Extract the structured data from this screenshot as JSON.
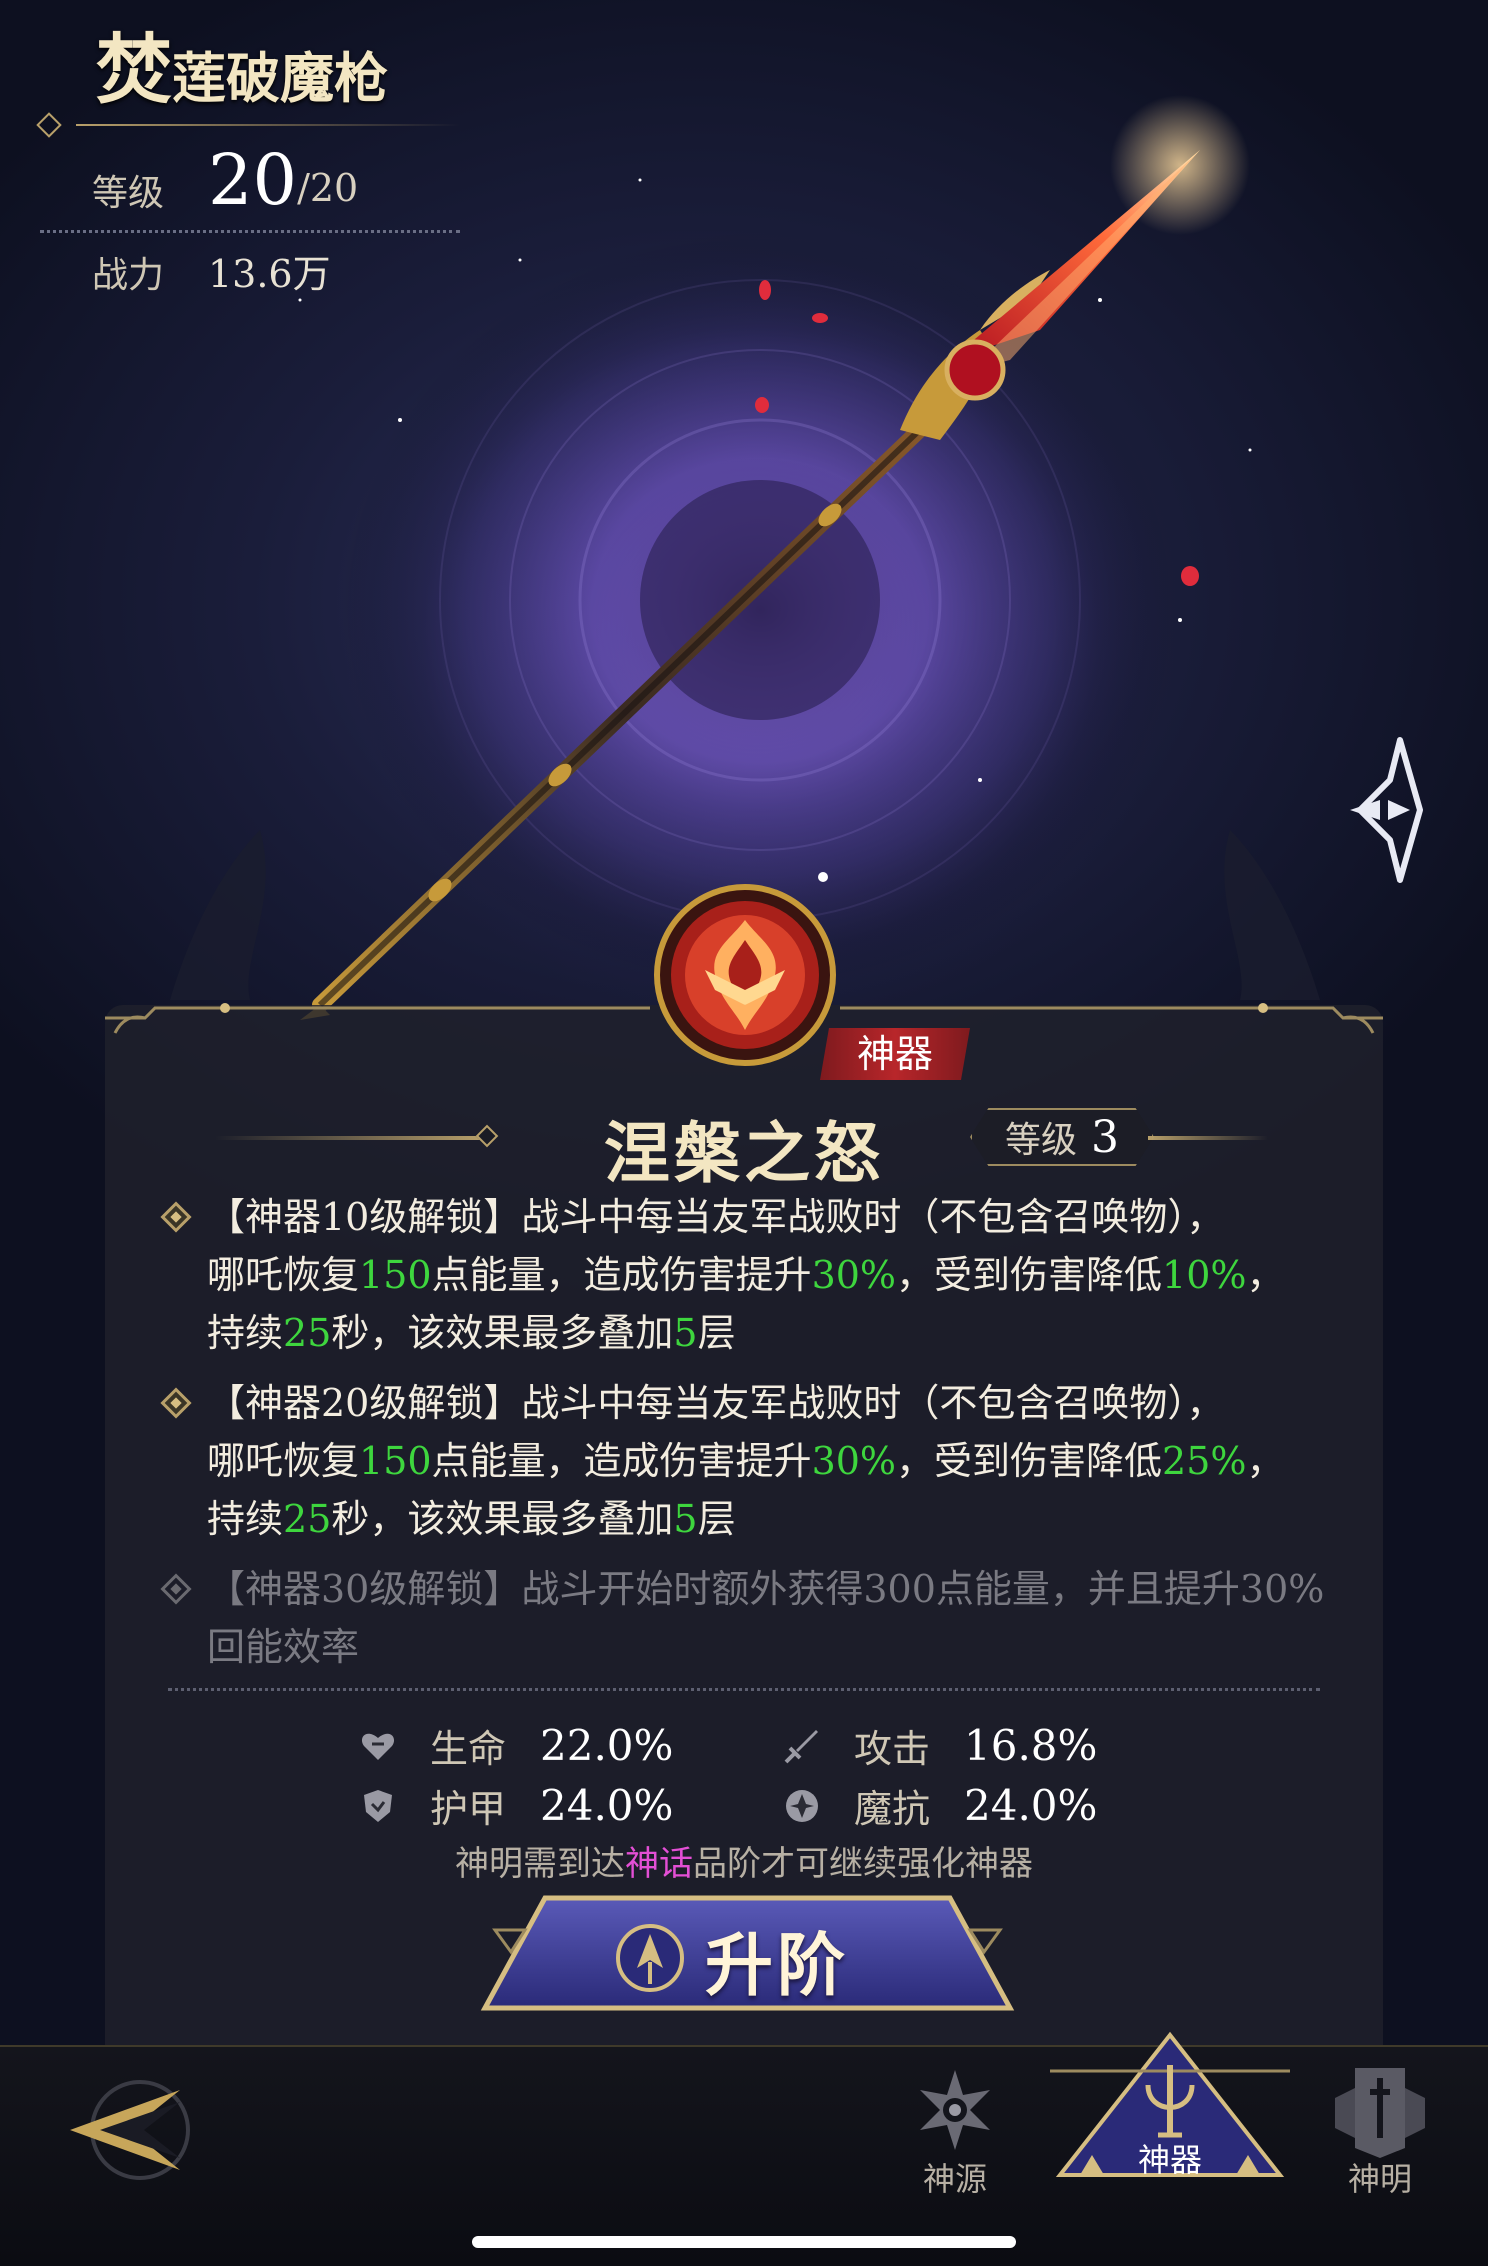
{
  "weapon": {
    "title_first_char": "焚",
    "title_rest": "莲破魔枪",
    "level_label": "等级",
    "level_value": "20",
    "level_max": "/20",
    "power_label": "战力",
    "power_value": "13.6万"
  },
  "panel": {
    "tag": "神器",
    "skill_name": "涅槃之怒",
    "level_label": "等级",
    "level_value": "3",
    "effects": [
      {
        "unlock": "【神器10级解锁】",
        "line1_text": "战斗中每当友军战败时（不包含召唤物），",
        "p1": "哪吒恢复",
        "v1": "150",
        "p2": "点能量，造成伤害提升",
        "v2": "30%",
        "p3": "，受到伤害降低",
        "v3": "10%",
        "p4": "，",
        "p5": "持续",
        "v4": "25",
        "p6": "秒，该效果最多叠加",
        "v5": "5",
        "p7": "层",
        "locked": false
      },
      {
        "unlock": "【神器20级解锁】",
        "line1_text": "战斗中每当友军战败时（不包含召唤物），",
        "p1": "哪吒恢复",
        "v1": "150",
        "p2": "点能量，造成伤害提升",
        "v2": "30%",
        "p3": "，受到伤害降低",
        "v3": "25%",
        "p4": "，",
        "p5": "持续",
        "v4": "25",
        "p6": "秒，该效果最多叠加",
        "v5": "5",
        "p7": "层",
        "locked": false
      },
      {
        "unlock": "【神器30级解锁】",
        "text": "战斗开始时额外获得300点能量，并且提升30%回能效率",
        "locked": true
      }
    ],
    "stats": {
      "hp_label": "生命",
      "hp_value": "22.0%",
      "atk_label": "攻击",
      "atk_value": "16.8%",
      "armor_label": "护甲",
      "armor_value": "24.0%",
      "mres_label": "魔抗",
      "mres_value": "24.0%"
    },
    "notice_pre": "神明需到达",
    "notice_highlight": "神话",
    "notice_post": "品阶才可继续强化神器",
    "upgrade_label": "升阶"
  },
  "nav": {
    "tab_shenyuan": "神源",
    "tab_shenqi": "神器",
    "tab_shenming": "神明",
    "active": "神器"
  },
  "colors": {
    "highlight_green": "#3ed63e",
    "highlight_pink": "#e34fd5",
    "gold": "#b8a06a",
    "tag_red": "#b8262a",
    "button_blue": "#3a3a9a"
  }
}
